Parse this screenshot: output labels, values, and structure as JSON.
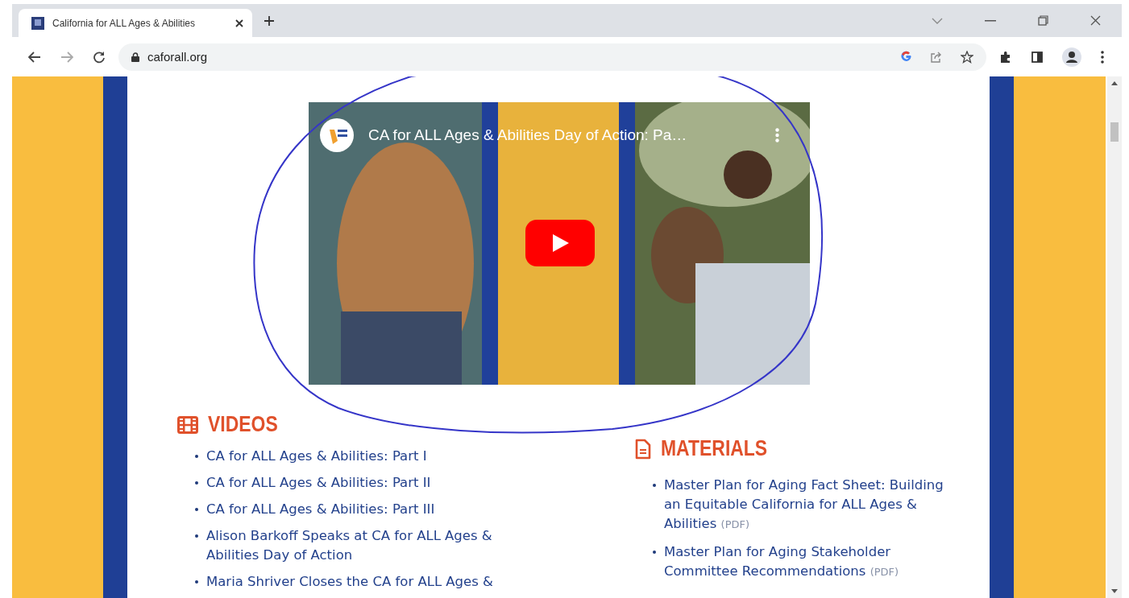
{
  "window": {
    "tab": {
      "title": "California for ALL Ages & Abilities",
      "selected": true
    },
    "address": "caforall.org"
  },
  "video": {
    "title": "CA for ALL Ages & Abilities Day of Action: Pa…"
  },
  "sections": [
    {
      "kind": "videos",
      "heading": "VIDEOS",
      "items": [
        {
          "text": "CA for ALL Ages & Abilities: Part I"
        },
        {
          "text": "CA for ALL Ages & Abilities: Part II"
        },
        {
          "text": "CA for ALL Ages & Abilities: Part III"
        },
        {
          "text": "Alison Barkoff Speaks at CA for ALL Ages & Abilities Day of Action"
        },
        {
          "text": "Maria Shriver Closes the CA for ALL Ages &"
        }
      ]
    },
    {
      "kind": "materials",
      "heading": "MATERIALS",
      "items": [
        {
          "text": "Master Plan for Aging Fact Sheet: Building an Equitable California for ALL Ages & Abilities",
          "suffix": "(PDF)"
        },
        {
          "text": "Master Plan for Aging Stakeholder Committee Recommendations",
          "suffix": "(PDF)"
        }
      ]
    }
  ]
}
